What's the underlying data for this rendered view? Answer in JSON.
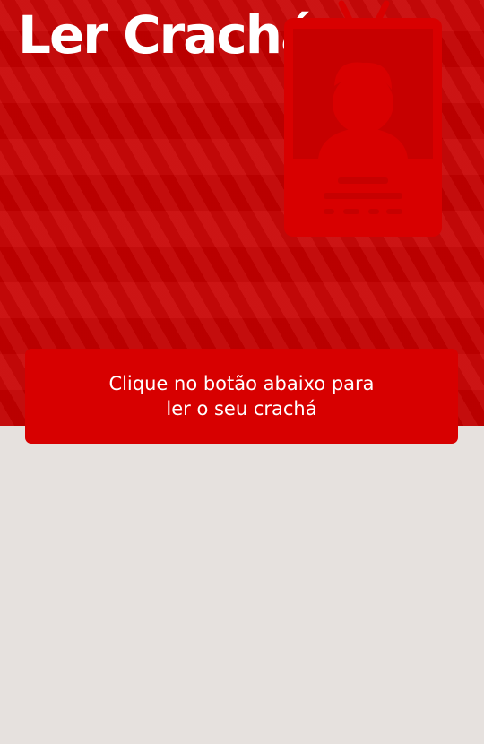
{
  "header": {
    "title": "Ler Crachá",
    "background_color": "#c70000",
    "illustration_icon": "id-badge-icon"
  },
  "card": {
    "instruction": "Clique no botão abaixo para ler o seu crachá",
    "background_color": "#d70000"
  },
  "page": {
    "background_color": "#e6e1de"
  }
}
